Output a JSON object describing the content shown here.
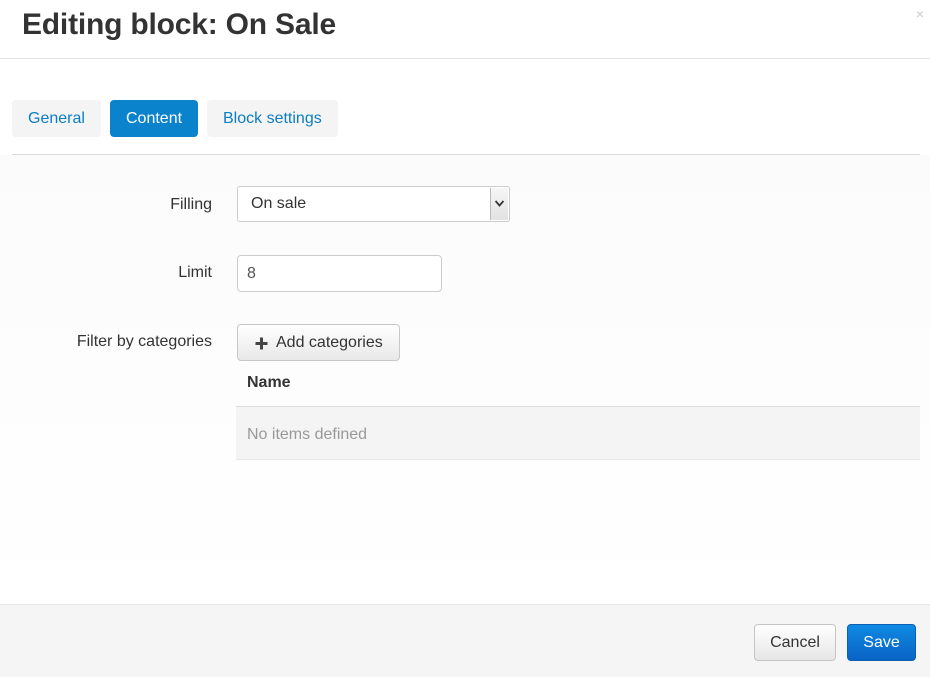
{
  "header": {
    "title": "Editing block: On Sale",
    "close_glyph": "×",
    "close_icon": "close-icon"
  },
  "tabs": [
    {
      "label": "General",
      "active": false
    },
    {
      "label": "Content",
      "active": true
    },
    {
      "label": "Block settings",
      "active": false
    }
  ],
  "form": {
    "filling": {
      "label": "Filling",
      "value": "On sale"
    },
    "limit": {
      "label": "Limit",
      "value": "8"
    },
    "filter": {
      "label": "Filter by categories",
      "button_label": "Add categories",
      "button_icon": "plus-icon"
    }
  },
  "table": {
    "columns": [
      "Name"
    ],
    "empty_text": "No items defined"
  },
  "footer": {
    "cancel_label": "Cancel",
    "save_label": "Save"
  },
  "colors": {
    "accent": "#0b83cc",
    "link": "#0b7dc1",
    "save": "#0a63c5"
  }
}
